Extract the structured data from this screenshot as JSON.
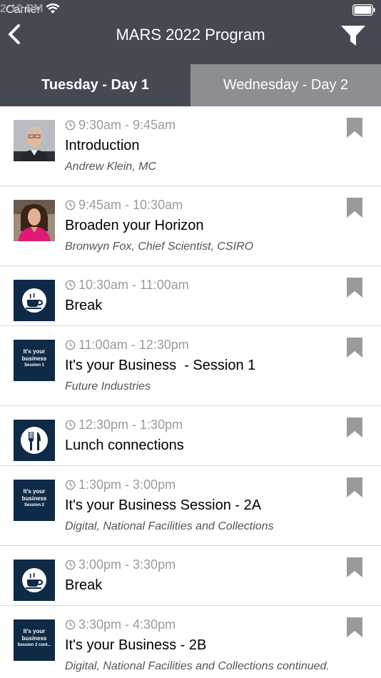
{
  "status": {
    "carrier": "Carrier",
    "time": "2:10 PM"
  },
  "nav": {
    "title": "MARS 2022 Program"
  },
  "tabs": [
    {
      "label": "Tuesday - Day 1",
      "active": true
    },
    {
      "label": "Wednesday - Day 2",
      "active": false
    }
  ],
  "sessions": [
    {
      "time": "9:30am - 9:45am",
      "title": "Introduction",
      "subtitle": "Andrew Klein, MC",
      "thumb": "photo-man"
    },
    {
      "time": "9:45am - 10:30am",
      "title": "Broaden your Horizon",
      "subtitle": "Bronwyn Fox, Chief Scientist, CSIRO",
      "thumb": "photo-woman"
    },
    {
      "time": "10:30am - 11:00am",
      "title": "Break",
      "subtitle": "",
      "thumb": "coffee-icon"
    },
    {
      "time": "11:00am - 12:30pm",
      "title": "It's your Business  - Session 1",
      "subtitle": "Future Industries",
      "thumb": "text",
      "thumb_text": "It's your business",
      "thumb_sub": "Session 1"
    },
    {
      "time": "12:30pm - 1:30pm",
      "title": "Lunch connections",
      "subtitle": "",
      "thumb": "cutlery-icon"
    },
    {
      "time": "1:30pm - 3:00pm",
      "title": "It's your Business Session - 2A",
      "subtitle": "Digital, National Facilities and Collections",
      "thumb": "text",
      "thumb_text": "It's your business",
      "thumb_sub": "Session 2"
    },
    {
      "time": "3:00pm - 3:30pm",
      "title": "Break",
      "subtitle": "",
      "thumb": "coffee-icon"
    },
    {
      "time": "3:30pm - 4:30pm",
      "title": "It's your Business - 2B",
      "subtitle": "Digital, National Facilities and Collections continued.",
      "thumb": "text",
      "thumb_text": "It's your business",
      "thumb_sub": "Session 2 cont..."
    }
  ],
  "colors": {
    "header": "#454a52",
    "tab_inactive": "#8c8e92",
    "thumb_navy": "#0e2a47",
    "muted": "#9b9b9b",
    "bookmark": "#9a9a9a"
  }
}
